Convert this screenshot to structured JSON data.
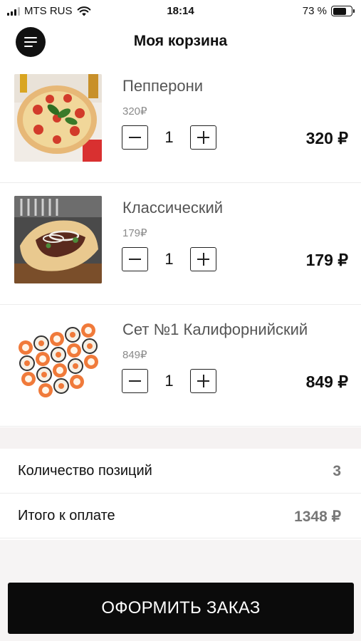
{
  "status_bar": {
    "carrier": "MTS RUS",
    "time": "18:14",
    "battery": "73 %",
    "battery_level": 0.73
  },
  "header": {
    "title": "Моя корзина",
    "menu_icon": "hamburger-menu-icon"
  },
  "cart": {
    "items": [
      {
        "name": "Пепперони",
        "unit_price": "320₽",
        "quantity": "1",
        "total": "320 ₽",
        "image_icon": "pizza-image"
      },
      {
        "name": "Классический",
        "unit_price": "179₽",
        "quantity": "1",
        "total": "179 ₽",
        "image_icon": "shawarma-image"
      },
      {
        "name": "Сет №1 Калифорнийский",
        "unit_price": "849₽",
        "quantity": "1",
        "total": "849 ₽",
        "image_icon": "sushi-set-image"
      }
    ]
  },
  "summary": {
    "positions_label": "Количество позиций",
    "positions_value": "3",
    "total_label": "Итого к оплате",
    "total_value": "1348 ₽"
  },
  "checkout": {
    "label": "ОФОРМИТЬ ЗАКАЗ"
  },
  "colors": {
    "primary": "#0b0b0b",
    "muted_text": "#777777",
    "background_band": "#f5f2f2"
  }
}
